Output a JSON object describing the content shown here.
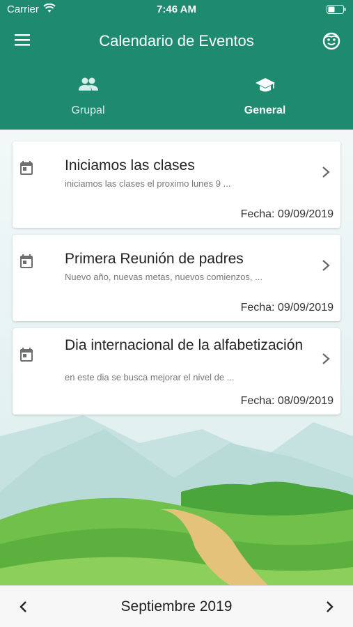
{
  "status_bar": {
    "carrier": "Carrier",
    "time": "7:46 AM"
  },
  "app_bar": {
    "title": "Calendario de Eventos"
  },
  "tabs": [
    {
      "label": "Grupal",
      "icon": "group-icon",
      "selected": false
    },
    {
      "label": "General",
      "icon": "school-icon",
      "selected": true
    }
  ],
  "events": [
    {
      "title": "Iniciamos las clases",
      "description": "iniciamos las clases el proximo lunes 9 ...",
      "date": "Fecha: 09/09/2019"
    },
    {
      "title": "Primera Reunión de padres",
      "description": "Nuevo año, nuevas metas, nuevos comienzos, ...",
      "date": "Fecha: 09/09/2019"
    },
    {
      "title": "Dia internacional de la alfabetización",
      "description": "en este dia se busca mejorar el nivel de ...",
      "date": "Fecha: 08/09/2019"
    }
  ],
  "month_nav": {
    "label": "Septiembre 2019"
  },
  "colors": {
    "primary": "#1e8a70",
    "card_background": "#ffffff",
    "grass": "#6cc14a",
    "path": "#e4c27a"
  }
}
